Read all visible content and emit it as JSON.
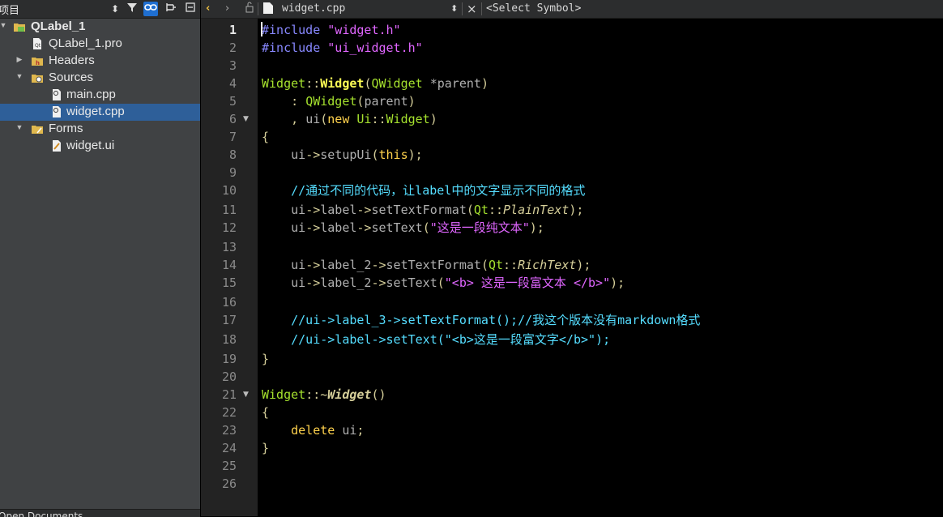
{
  "project_pane": {
    "title": "项目",
    "tree": [
      {
        "label": "QLabel_1",
        "bold": true,
        "arrow": "▼",
        "icon": "project-folder-icon"
      },
      {
        "label": "QLabel_1.pro",
        "icon": "pro-file-icon"
      },
      {
        "label": "Headers",
        "arrow": "▶",
        "icon": "headers-folder-icon"
      },
      {
        "label": "Sources",
        "arrow": "▼",
        "icon": "sources-folder-icon"
      },
      {
        "label": "main.cpp",
        "icon": "cpp-file-icon"
      },
      {
        "label": "widget.cpp",
        "icon": "cpp-file-icon",
        "selected": true
      },
      {
        "label": "Forms",
        "arrow": "▼",
        "icon": "forms-folder-icon"
      },
      {
        "label": "widget.ui",
        "icon": "ui-file-icon"
      }
    ],
    "open_documents_label": "Open Documents"
  },
  "editor_toolbar": {
    "file_name": "widget.cpp",
    "symbol_placeholder": "<Select Symbol>"
  },
  "editor": {
    "current_line": 1,
    "line_numbers": [
      "1",
      "2",
      "3",
      "4",
      "5",
      "6",
      "7",
      "8",
      "9",
      "10",
      "11",
      "12",
      "13",
      "14",
      "15",
      "16",
      "17",
      "18",
      "19",
      "20",
      "21",
      "22",
      "23",
      "24",
      "25",
      "26"
    ],
    "fold_lines": [
      6,
      21
    ],
    "lines": [
      "#include \"widget.h\"",
      "#include \"ui_widget.h\"",
      "",
      "Widget::Widget(QWidget *parent)",
      "    : QWidget(parent)",
      "    , ui(new Ui::Widget)",
      "{",
      "    ui->setupUi(this);",
      "",
      "    //通过不同的代码，让label中的文字显示不同的格式",
      "    ui->label->setTextFormat(Qt::PlainText);",
      "    ui->label->setText(\"这是一段纯文本\");",
      "",
      "    ui->label_2->setTextFormat(Qt::RichText);",
      "    ui->label_2->setText(\"<b> 这是一段富文本 </b>\");",
      "",
      "    //ui->label_3->setTextFormat();//我这个版本没有markdown格式",
      "    //ui->label->setText(\"<b>这是一段富文字</b>\");",
      "}",
      "",
      "Widget::~Widget()",
      "{",
      "    delete ui;",
      "}",
      "",
      ""
    ]
  },
  "colors": {
    "keyword": "#a6e22e",
    "string": "#e066ff",
    "comment": "#55ddff",
    "selection": "#2e5f99"
  }
}
